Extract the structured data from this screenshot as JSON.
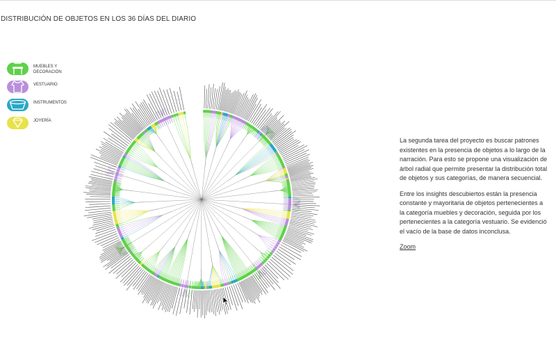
{
  "title": "DISTRIBUCIÓN DE OBJETOS EN LOS 36 DÍAS DEL DIARIO",
  "legend": [
    {
      "label": "MUEBLES Y DECORACIÓN",
      "color": "#5fd14a",
      "icon": "chair-icon"
    },
    {
      "label": "VESTUARIO",
      "color": "#b98fdc",
      "icon": "shirt-icon"
    },
    {
      "label": "INSTRUMENTOS",
      "color": "#2aa7c6",
      "icon": "drum-icon"
    },
    {
      "label": "JOYERÍA",
      "color": "#e8e24a",
      "icon": "diamond-icon"
    }
  ],
  "description": {
    "paragraph1": "La segunda tarea del proyecto es buscar patrones existentes en la presencia de objetos a lo largo de la narración. Para esto se propone una visualización de árbol radial que permite presentar la distribución total de objetos y sus categorías, de manera secuencial.",
    "paragraph2": "Entre los insights descubiertos están la presencia constante y mayoritaria de objetos pertenecientes a la categoría muebles y decoración, seguida por los pertenecientes a la categoría vestuario. Se evidenció el vacío de la base de datos inconclusa.",
    "zoom_link": "Zoom"
  }
}
